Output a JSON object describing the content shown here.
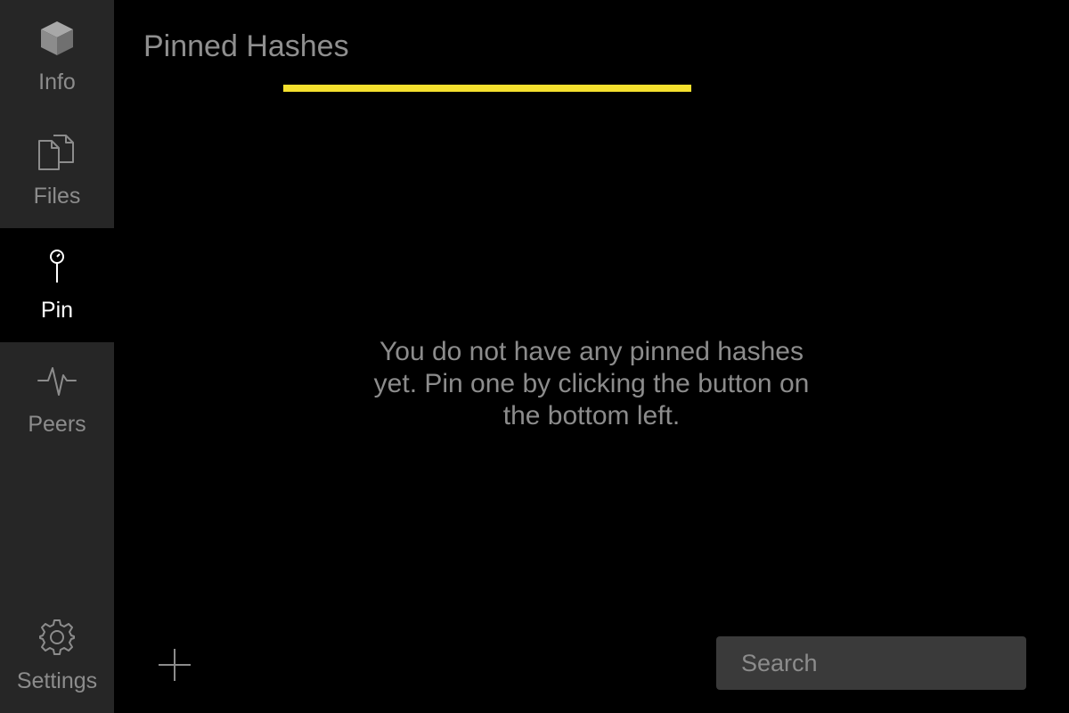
{
  "sidebar": {
    "items": [
      {
        "label": "Info",
        "icon": "cube-icon",
        "active": false
      },
      {
        "label": "Files",
        "icon": "files-icon",
        "active": false
      },
      {
        "label": "Pin",
        "icon": "pin-icon",
        "active": true
      },
      {
        "label": "Peers",
        "icon": "pulse-icon",
        "active": false
      }
    ],
    "settings": {
      "label": "Settings",
      "icon": "gear-icon"
    }
  },
  "main": {
    "title": "Pinned Hashes",
    "progress": 1.0,
    "empty_message": "You do not have any pinned hashes yet. Pin one by clicking the button on the bottom left.",
    "add_icon": "plus-icon",
    "search": {
      "placeholder": "Search",
      "value": ""
    }
  },
  "colors": {
    "background": "#000000",
    "sidebar": "#262626",
    "accent": "#f5e02e",
    "muted_text": "#8c8c8c",
    "active_text": "#ffffff",
    "search_bg": "#3a3a3a"
  }
}
